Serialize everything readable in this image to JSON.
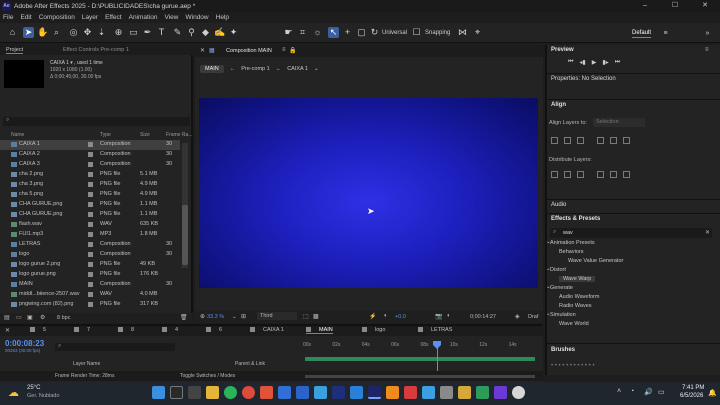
{
  "window": {
    "title": "Adobe After Effects 2025 - D:\\PUBLICIDADES\\cha gurue.aep *",
    "minimize": "–",
    "maximize": "☐",
    "close": "✕"
  },
  "menu": [
    "File",
    "Edit",
    "Composition",
    "Layer",
    "Effect",
    "Animation",
    "View",
    "Window",
    "Help"
  ],
  "toolbar": {
    "universal": "Universal",
    "snapping": "Snapping",
    "workspace": "Default"
  },
  "project": {
    "tab": "Project",
    "effect_controls_tab": "Effect Controls Pre-comp 1",
    "selected_name": "CAIXA 1 ▾ , used 1 time",
    "selected_dims": "1920 x 1080 (1.00)",
    "selected_dur": "Δ 0;00;45;00, 30.00 fps",
    "columns": {
      "name": "Name",
      "type": "Type",
      "size": "Size",
      "frame": "Frame Ra..."
    },
    "bpc": "8 bpc",
    "items": [
      {
        "name": "CAIXA 1",
        "type": "Composition",
        "size": "",
        "frame": "30"
      },
      {
        "name": "CAIXA 2",
        "type": "Composition",
        "size": "",
        "frame": "30"
      },
      {
        "name": "CAIXA 3",
        "type": "Composition",
        "size": "",
        "frame": "30"
      },
      {
        "name": "cha 2.png",
        "type": "PNG file",
        "size": "5.1 MB",
        "frame": ""
      },
      {
        "name": "cha 3.png",
        "type": "PNG file",
        "size": "4.9 MB",
        "frame": ""
      },
      {
        "name": "cha 5.png",
        "type": "PNG file",
        "size": "4.9 MB",
        "frame": ""
      },
      {
        "name": "CHA GURUE.png",
        "type": "PNG file",
        "size": "1.1 MB",
        "frame": ""
      },
      {
        "name": "CHA GURUE.png",
        "type": "PNG file",
        "size": "1.1 MB",
        "frame": ""
      },
      {
        "name": "flash.wav",
        "type": "WAV",
        "size": "635 KB",
        "frame": ""
      },
      {
        "name": "FUI1.mp3",
        "type": "MP3",
        "size": "1.8 MB",
        "frame": ""
      },
      {
        "name": "LETRAS",
        "type": "Composition",
        "size": "",
        "frame": "30"
      },
      {
        "name": "logo",
        "type": "Composition",
        "size": "",
        "frame": "30"
      },
      {
        "name": "logo gurue 2.png",
        "type": "PNG file",
        "size": "49 KB",
        "frame": ""
      },
      {
        "name": "logo gurue.png",
        "type": "PNG file",
        "size": "176 KB",
        "frame": ""
      },
      {
        "name": "MAIN",
        "type": "Composition",
        "size": "",
        "frame": "30"
      },
      {
        "name": "middl...biience-2507.wav",
        "type": "WAV",
        "size": "4.0 MB",
        "frame": ""
      },
      {
        "name": "pngwing.com (82).png",
        "type": "PNG file",
        "size": "317 KB",
        "frame": ""
      }
    ]
  },
  "viewer": {
    "tab": "Composition MAIN",
    "tabs": [
      "MAIN",
      "Pre-comp 1",
      "CAIXA 1"
    ],
    "zoom": "33.3 %",
    "resolution": "Third",
    "timecode": "0;00:14:27",
    "exposure": "+0.0",
    "draft": "Draf"
  },
  "right": {
    "preview": "Preview",
    "properties": "Properties: No Selection",
    "align": "Align",
    "align_to": "Align Layers to:",
    "align_to_value": "Selection",
    "distribute": "Distribute Layers:",
    "audio": "Audio",
    "effects": "Effects & Presets",
    "search": "wav",
    "fx": [
      {
        "label": "Animation Presets",
        "indent": 0
      },
      {
        "label": "Behaviors",
        "indent": 1
      },
      {
        "label": "Wave Value Generator",
        "indent": 2
      },
      {
        "label": "Distort",
        "indent": 0
      },
      {
        "label": "Wave Warp",
        "indent": 1
      },
      {
        "label": "Generate",
        "indent": 0
      },
      {
        "label": "Audio Waveform",
        "indent": 1
      },
      {
        "label": "Radio Waves",
        "indent": 1
      },
      {
        "label": "Simulation",
        "indent": 0
      },
      {
        "label": "Wave World",
        "indent": 1
      }
    ],
    "brushes": "Brushes"
  },
  "timeline": {
    "tabs": [
      "5",
      "7",
      "8",
      "4",
      "6",
      "CAIXA 1",
      "MAIN",
      "logo",
      "LETRAS"
    ],
    "timecode": "0:00:08:23",
    "tc_sub": "00263 (30.00 fps)",
    "ruler": [
      "00s",
      "02s",
      "04s",
      "06s",
      "08s",
      "10s",
      "12s",
      "14s"
    ],
    "layer_name": "Layer Name",
    "parent": "Parent & Link",
    "frame_render": "Frame Render Time: 28ms",
    "toggle": "Toggle Switches / Modes"
  },
  "taskbar": {
    "temp": "25°C",
    "weather": "Ger. Nublado",
    "time": "7:41 PM",
    "date": "6/5/2026"
  }
}
